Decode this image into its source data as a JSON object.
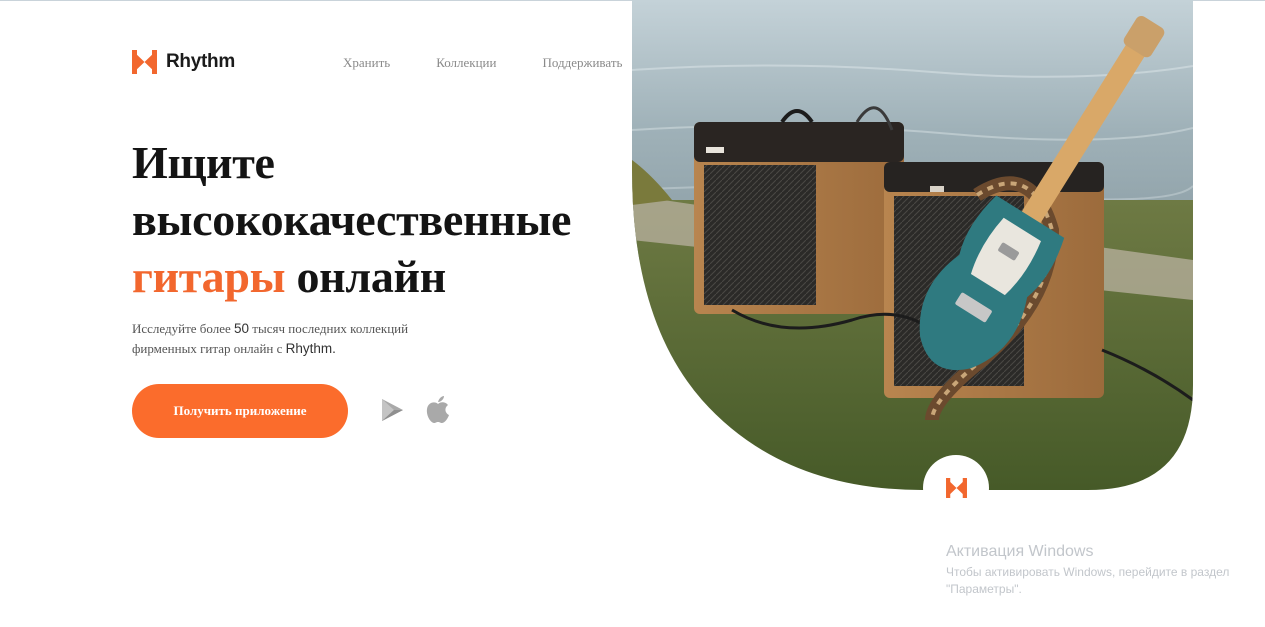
{
  "brand": {
    "name": "Rhythm",
    "logo_icon": "rhythm-logo-icon",
    "accent_color": "#f2672e"
  },
  "nav": {
    "items": [
      "Хранить",
      "Коллекции",
      "Поддерживать"
    ]
  },
  "hero": {
    "title_line1": "Ищите",
    "title_line2": "высококачественные",
    "title_accent": "гитары",
    "title_rest": " онлайн",
    "description_part1": "Исследуйте более ",
    "description_number": "50",
    "description_part2": " тысяч последних коллекций фирменных гитар онлайн с ",
    "description_brand": "Rhythm.",
    "cta_label": "Получить приложение",
    "cta_color": "#fb6c2c",
    "store_icons": [
      "google-play-icon",
      "apple-icon"
    ]
  },
  "image": {
    "subject": "hero-guitar-amps-photo"
  },
  "watermark": {
    "title": "Активация Windows",
    "text": "Чтобы активировать Windows, перейдите в раздел \"Параметры\"."
  }
}
